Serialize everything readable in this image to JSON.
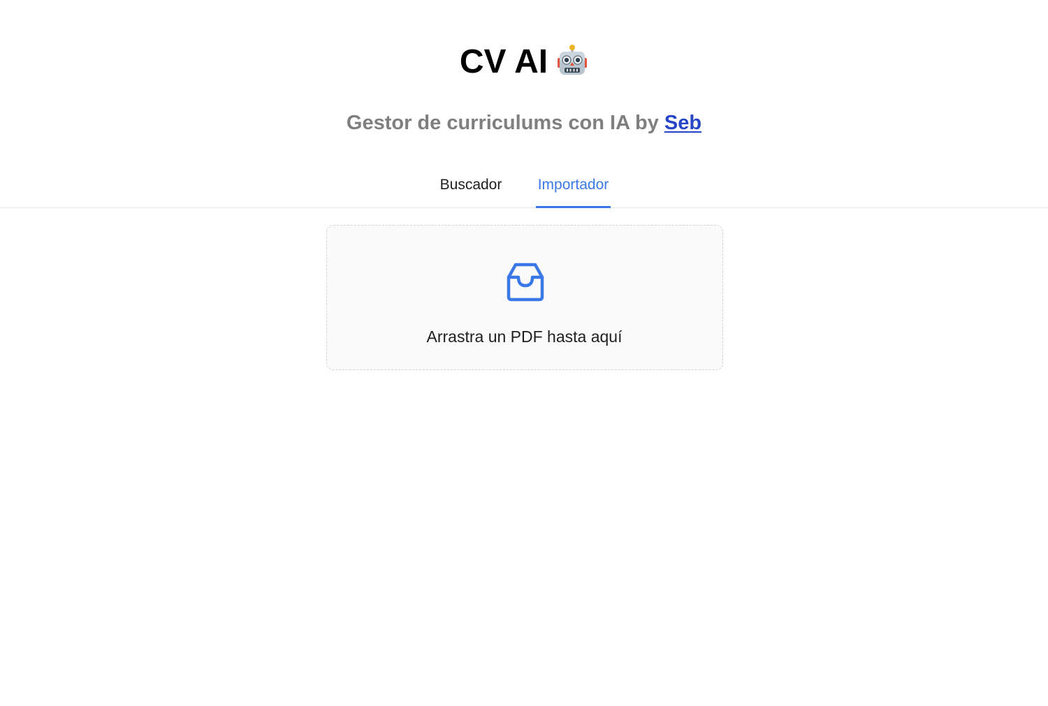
{
  "header": {
    "title": "CV AI",
    "title_icon": "robot-icon",
    "subtitle_prefix": "Gestor de curriculums con IA by ",
    "author_link": "Seb"
  },
  "tabs": [
    {
      "label": "Buscador",
      "active": false
    },
    {
      "label": "Importador",
      "active": true
    }
  ],
  "dropzone": {
    "icon": "inbox-icon",
    "text": "Arrastra un PDF hasta aquí"
  },
  "colors": {
    "accent": "#3b78e7",
    "link": "#2745c7",
    "subtitle": "#7f7f7f",
    "dropzone_bg": "#fafafa",
    "dropzone_border": "#d4d4d4"
  }
}
